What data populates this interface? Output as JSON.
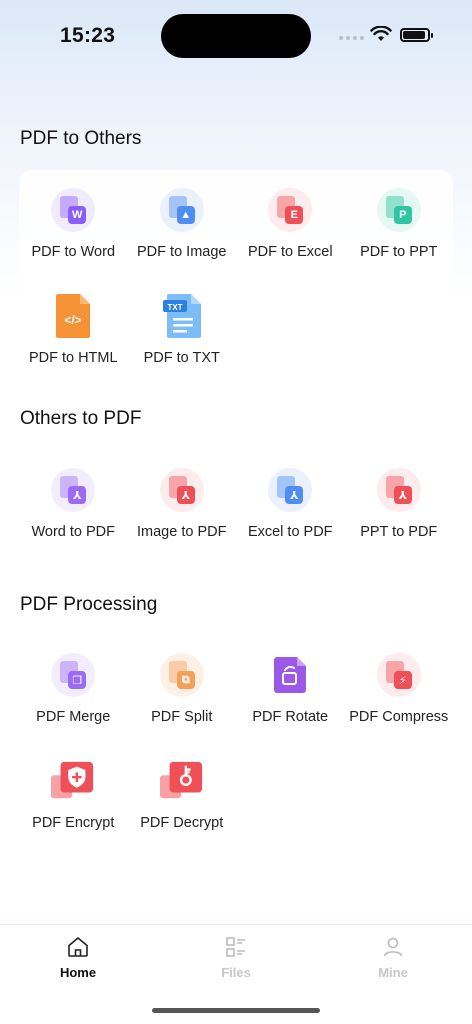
{
  "status": {
    "time": "15:23"
  },
  "sections": [
    {
      "title": "PDF to Others",
      "tools": [
        {
          "label": "PDF to Word",
          "icon": "word-icon",
          "glyph": "W",
          "color": "#8b5cf6",
          "bg": "#f1ecfd"
        },
        {
          "label": "PDF to Image",
          "icon": "image-icon",
          "glyph": "▲",
          "color": "#4f8ef0",
          "bg": "#eaf1fd"
        },
        {
          "label": "PDF to Excel",
          "icon": "excel-icon",
          "glyph": "E",
          "color": "#ef4f56",
          "bg": "#fdeced"
        },
        {
          "label": "PDF to PPT",
          "icon": "ppt-icon",
          "glyph": "P",
          "color": "#2dc5a2",
          "bg": "#e6f8f3"
        },
        {
          "label": "PDF to HTML",
          "icon": "html-file-icon",
          "glyph": "</>",
          "color": "#f59236",
          "bg": "transparent"
        },
        {
          "label": "PDF to TXT",
          "icon": "txt-file-icon",
          "glyph": "TXT",
          "color": "#5aa8f5",
          "bg": "transparent"
        }
      ]
    },
    {
      "title": "Others to PDF",
      "tools": [
        {
          "label": "Word to PDF",
          "icon": "word-to-pdf-icon",
          "glyph": "⅄",
          "color": "#9b6cf3",
          "bg": "#f3eefe"
        },
        {
          "label": "Image to PDF",
          "icon": "image-to-pdf-icon",
          "glyph": "⅄",
          "color": "#ef4f56",
          "bg": "#fdeced"
        },
        {
          "label": "Excel to PDF",
          "icon": "excel-to-pdf-icon",
          "glyph": "⅄",
          "color": "#4f8ef0",
          "bg": "#eaf1fd"
        },
        {
          "label": "PPT to PDF",
          "icon": "ppt-to-pdf-icon",
          "glyph": "⅄",
          "color": "#ef4f56",
          "bg": "#fdeced"
        }
      ]
    },
    {
      "title": "PDF Processing",
      "tools": [
        {
          "label": "PDF Merge",
          "icon": "merge-icon",
          "glyph": "❐",
          "color": "#9b6cf3",
          "bg": "#f3eefe"
        },
        {
          "label": "PDF Split",
          "icon": "split-icon",
          "glyph": "⧉",
          "color": "#f5a05a",
          "bg": "#fdf1e6"
        },
        {
          "label": "PDF Rotate",
          "icon": "rotate-icon",
          "glyph": "↻",
          "color": "#9b59e8",
          "bg": "transparent"
        },
        {
          "label": "PDF Compress",
          "icon": "compress-icon",
          "glyph": "⚡",
          "color": "#ef4f56",
          "bg": "#fdeced"
        },
        {
          "label": "PDF Encrypt",
          "icon": "encrypt-shield-icon",
          "glyph": "+",
          "color": "#ef4f56",
          "bg": "transparent"
        },
        {
          "label": "PDF Decrypt",
          "icon": "decrypt-key-icon",
          "glyph": "⚷",
          "color": "#ef4f56",
          "bg": "transparent"
        }
      ]
    }
  ],
  "tabs": [
    {
      "label": "Home",
      "icon": "home-icon",
      "active": true
    },
    {
      "label": "Files",
      "icon": "files-icon",
      "active": false
    },
    {
      "label": "Mine",
      "icon": "user-icon",
      "active": false
    }
  ]
}
